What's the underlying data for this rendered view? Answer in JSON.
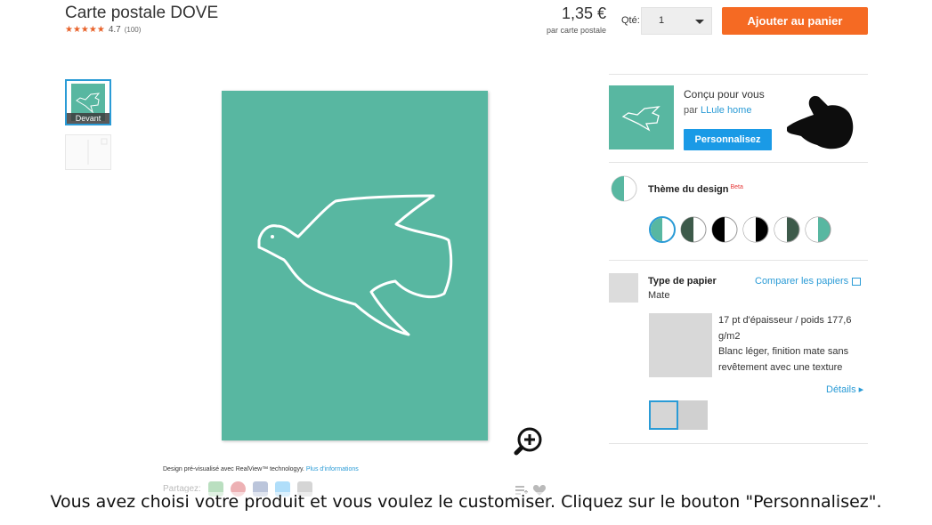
{
  "header": {
    "product_title": "Carte postale DOVE",
    "rating": "4.7",
    "rating_count": "(100)",
    "stars": "★★★★★",
    "price": "1,35 €",
    "price_sub": "par carte postale",
    "qty_label": "Qté:",
    "qty_value": "1",
    "add_to_cart_label": "Ajouter au panier"
  },
  "thumbnails": {
    "front_label": "Devant"
  },
  "preview": {
    "realview_text": "Design pré-visualisé avec RealView™ technologyy.",
    "realview_more": "Plus d'informations",
    "share_label": "Partagez:"
  },
  "design": {
    "designed_for": "Conçu pour vous",
    "by_prefix": "par ",
    "designer": "LLule home",
    "personalize_label": "Personnalisez"
  },
  "theme": {
    "title": "Thème du design",
    "beta": "Beta"
  },
  "paper": {
    "title": "Type de papier",
    "value": "Mate",
    "compare_label": "Comparer les papiers",
    "description_line1": "17 pt d'épaisseur / poids 177,6 g/m2",
    "description_line2": "Blanc léger, finition mate sans revêtement avec une texture",
    "details_label": "Détails ▸"
  },
  "caption": "Vous avez choisi votre produit et vous voulez le customiser. Cliquez sur le bouton \"Personnalisez\".",
  "colors": {
    "teal": "#58b7a1",
    "orange": "#f56a23",
    "blue": "#1a9ae6",
    "dark_green": "#3d5a4a"
  },
  "icons": [
    "zoom-in-icon",
    "pointing-hand-icon",
    "compare-window-icon",
    "email-icon",
    "pinterest-icon",
    "facebook-icon",
    "twitter-icon",
    "link-icon",
    "heart-icon"
  ]
}
